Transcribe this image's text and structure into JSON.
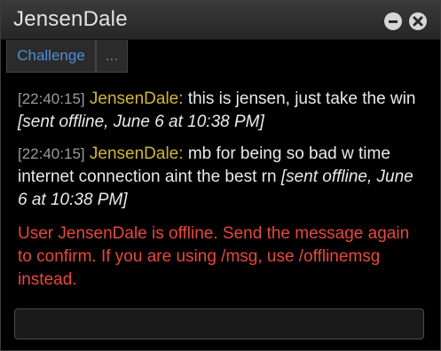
{
  "window": {
    "title": "JensenDale",
    "minimize_icon": "minimize-icon",
    "close_icon": "close-icon"
  },
  "tabs": [
    {
      "label": "Challenge"
    },
    {
      "label": "..."
    }
  ],
  "messages": [
    {
      "timestamp": "[22:40:15]",
      "sender": "JensenDale:",
      "text": "this is jensen, just take the win",
      "note": "[sent offline, June 6 at 10:38 PM]"
    },
    {
      "timestamp": "[22:40:15]",
      "sender": "JensenDale:",
      "text": "mb for being so bad w time internet connection aint the best rn",
      "note": "[sent offline, June 6 at 10:38 PM]"
    }
  ],
  "system_message": "User JensenDale is offline. Send the message again to confirm. If you are using /msg, use /offlinemsg instead.",
  "input": {
    "value": "",
    "placeholder": ""
  },
  "colors": {
    "sender": "#d2b43a",
    "system": "#e8473d",
    "tab_text": "#4c8ed8",
    "timestamp": "#9a9a9a"
  }
}
